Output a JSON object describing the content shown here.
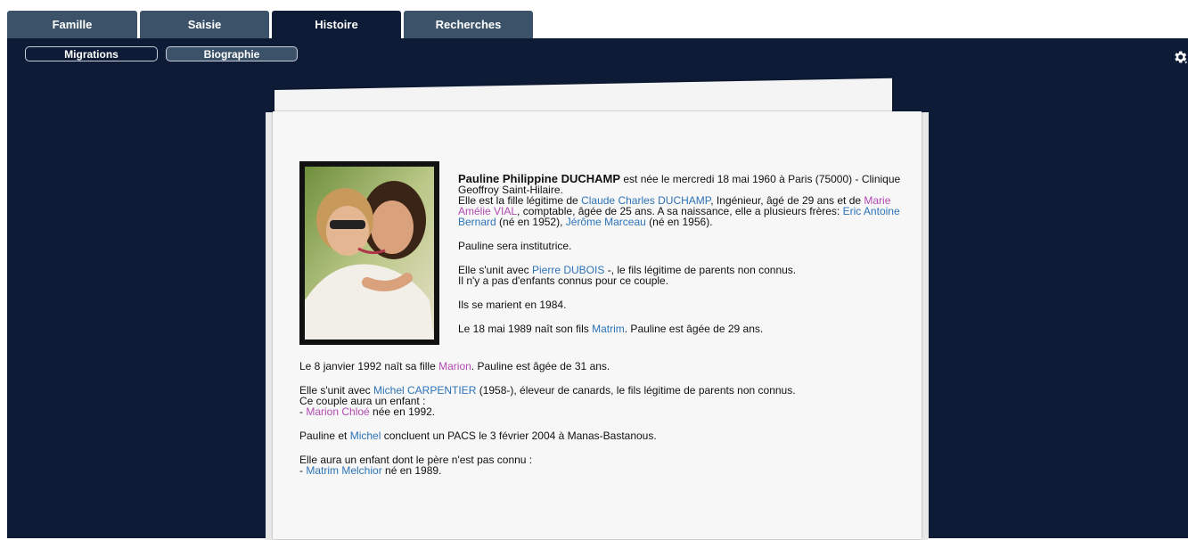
{
  "tabs": [
    "Famille",
    "Saisie",
    "Histoire",
    "Recherches"
  ],
  "subnav": {
    "migrations": "Migrations",
    "biographie": "Biographie"
  },
  "icons": {
    "settings": "gear-icon"
  },
  "colors": {
    "navy": "#0d1b36",
    "tab": "#3b5269",
    "male_link": "#2d73b7",
    "female_link": "#b24ab2"
  },
  "bio": {
    "p1": {
      "name": "Pauline Philippine DUCHAMP",
      "born": " est née le mercredi 18 mai 1960 à Paris (75000) - Clinique Geoffroy Saint-Hilaire.",
      "daughter_of": "Elle est la fille légitime de ",
      "father": "Claude Charles DUCHAMP",
      "father_info": ", Ingénieur, âgé de 29 ans et de ",
      "mother": "Marie Amélie VIAL",
      "mother_info": ", comptable, âgée de 25 ans. A sa naissance, elle a plusieurs frères: ",
      "brother1": "Eric Antoine Bernard",
      "brother1_info": " (né en 1952), ",
      "brother2": "Jérôme Marceau",
      "brother2_info": " (né en 1956)."
    },
    "p2": "Pauline sera institutrice.",
    "p3": {
      "pre": "Elle s'unit avec ",
      "partner": "Pierre DUBOIS",
      "post": " -, le fils légitime de parents non connus.",
      "line2": "Il n'y a pas d'enfants connus pour ce couple."
    },
    "p4": "Ils se marient en 1984.",
    "p5": {
      "pre": "Le 18 mai 1989 naît son fils ",
      "child": "Matrim",
      "post": ". Pauline est âgée de 29 ans."
    },
    "p6": {
      "pre": "Le 8 janvier 1992 naît sa fille ",
      "child": "Marion",
      "post": ". Pauline est âgée de 31 ans."
    },
    "p7": {
      "pre": "Elle s'unit avec ",
      "partner": "Michel CARPENTIER",
      "post": " (1958-), éleveur de canards, le fils légitime de parents non connus.",
      "line2": "Ce couple aura un enfant :",
      "dash": "- ",
      "child": "Marion Chloé",
      "child_post": " née en 1992."
    },
    "p8": {
      "pre": "Pauline et ",
      "partner": "Michel",
      "post": " concluent un PACS le 3 février 2004 à Manas-Bastanous."
    },
    "p9": {
      "line1": "Elle aura un enfant dont le père n'est pas connu :",
      "dash": "- ",
      "child": "Matrim Melchior",
      "post": " né en 1989."
    }
  }
}
